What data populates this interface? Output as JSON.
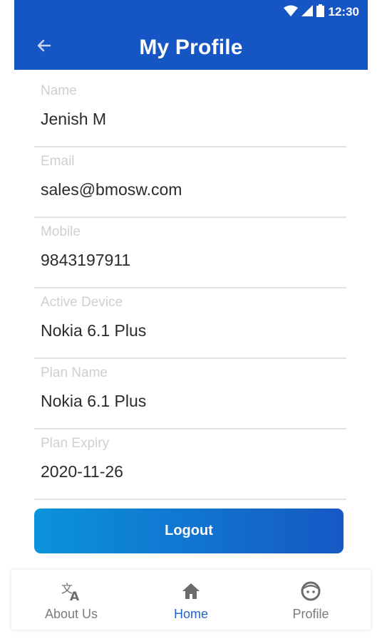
{
  "status_bar": {
    "time": "12:30"
  },
  "header": {
    "title": "My Profile",
    "back_icon": "arrow-left-icon"
  },
  "fields": [
    {
      "label": "Name",
      "value": "Jenish M"
    },
    {
      "label": "Email",
      "value": "sales@bmosw.com"
    },
    {
      "label": "Mobile",
      "value": "9843197911"
    },
    {
      "label": "Active Device",
      "value": "Nokia 6.1 Plus"
    },
    {
      "label": "Plan Name",
      "value": "Nokia 6.1 Plus"
    },
    {
      "label": "Plan Expiry",
      "value": "2020-11-26"
    }
  ],
  "logout_button": {
    "label": "Logout"
  },
  "bottom_nav": {
    "items": [
      {
        "label": "About Us",
        "icon": "translate-icon",
        "active": false
      },
      {
        "label": "Home",
        "icon": "home-icon",
        "active": true
      },
      {
        "label": "Profile",
        "icon": "face-icon",
        "active": false
      }
    ]
  },
  "colors": {
    "primary": "#1656c4",
    "gradient_start": "#0b93dc",
    "active_nav": "#2563c9"
  }
}
